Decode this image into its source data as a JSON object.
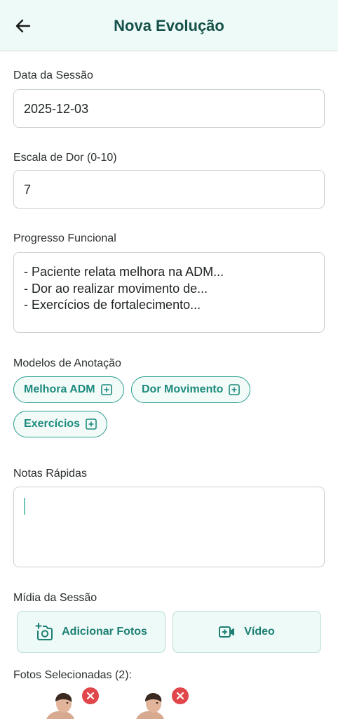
{
  "header": {
    "title": "Nova Evolução"
  },
  "session_date": {
    "label": "Data da Sessão",
    "value": "2025-12-03"
  },
  "pain_scale": {
    "label": "Escala de Dor (0-10)",
    "value": "7"
  },
  "functional_progress": {
    "label": "Progresso Funcional",
    "lines": [
      "- Paciente relata melhora na ADM...",
      "- Dor ao realizar movimento de...",
      "- Exercícios de fortalecimento..."
    ]
  },
  "templates": {
    "label": "Modelos de Anotação",
    "chips": [
      "Melhora ADM",
      "Dor Movimento",
      "Exercícios"
    ]
  },
  "quick_notes": {
    "label": "Notas Rápidas",
    "value": ""
  },
  "media": {
    "label": "Mídia da Sessão",
    "add_photos_label": "Adicionar Fotos",
    "video_label": "Vídeo"
  },
  "selected_photos": {
    "label": "Fotos Selecionadas (2):"
  },
  "colors": {
    "accent": "#2a9d8f",
    "header_bg": "#eefaf7",
    "title": "#15504a",
    "remove": "#e0464a"
  }
}
